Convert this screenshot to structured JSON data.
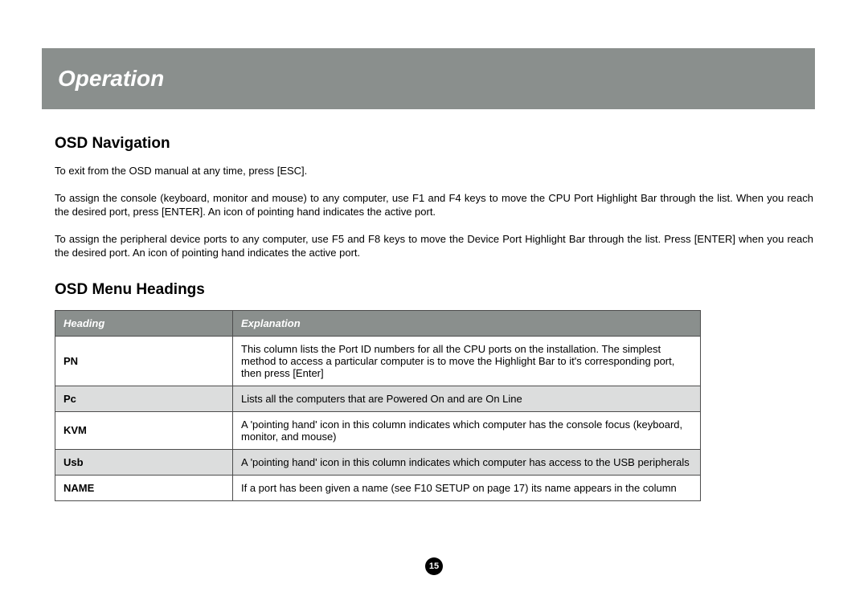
{
  "banner": {
    "title": "Operation"
  },
  "nav": {
    "heading": "OSD Navigation",
    "p1": "To exit from the OSD manual at any time, press [ESC].",
    "p2": "To assign the console (keyboard, monitor and mouse) to any computer, use F1 and F4 keys to move the CPU Port Highlight Bar through the list. When you reach the desired port, press [ENTER]. An icon of pointing hand indicates the active port.",
    "p3": "To assign the peripheral device ports to any computer, use F5 and F8 keys to move the Device Port Highlight Bar through the list.  Press [ENTER] when you reach the desired port. An icon of pointing hand indicates the active port."
  },
  "menu": {
    "heading": "OSD Menu Headings",
    "col1": "Heading",
    "col2": "Explanation",
    "rows": [
      {
        "h": "PN",
        "e": "This column lists the Port ID numbers for all the CPU ports on the installation. The simplest method to access a particular computer is to move the Highlight Bar to it's corresponding port, then press [Enter]"
      },
      {
        "h": "Pc",
        "e": "Lists all the computers that are Powered On and are On Line"
      },
      {
        "h": "KVM",
        "e": "A 'pointing hand' icon in this column indicates which computer has the console focus (keyboard, monitor, and mouse)"
      },
      {
        "h": "Usb",
        "e": "A 'pointing hand' icon in this column indicates which computer has access to the USB peripherals"
      },
      {
        "h": "NAME",
        "e": "If a port has been given a name (see F10 SETUP on page 17) its name appears in the column"
      }
    ]
  },
  "pageNumber": "15"
}
